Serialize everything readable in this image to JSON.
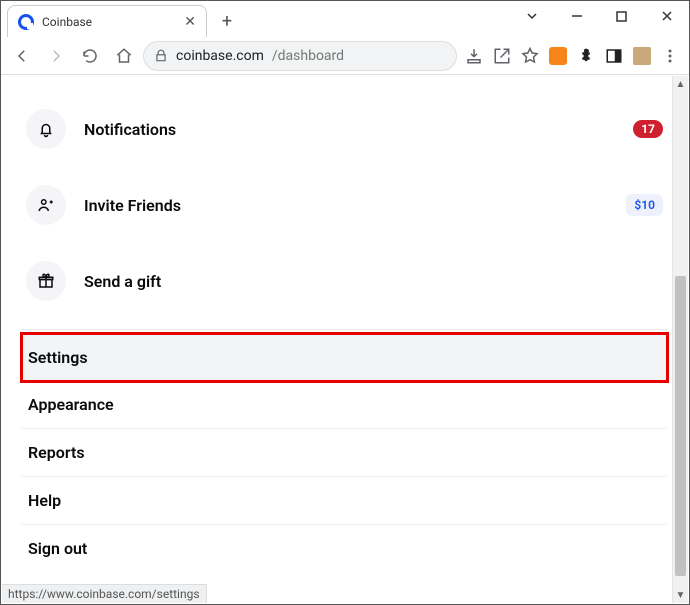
{
  "browser": {
    "tab_title": "Coinbase",
    "url_host": "coinbase.com",
    "url_path": "/dashboard",
    "status_link": "https://www.coinbase.com/settings"
  },
  "menu": {
    "notifications": {
      "label": "Notifications",
      "badge": "17"
    },
    "invite": {
      "label": "Invite Friends",
      "badge": "$10"
    },
    "gift": {
      "label": "Send a gift"
    }
  },
  "sections": {
    "settings": "Settings",
    "appearance": "Appearance",
    "reports": "Reports",
    "help": "Help",
    "signout": "Sign out"
  }
}
